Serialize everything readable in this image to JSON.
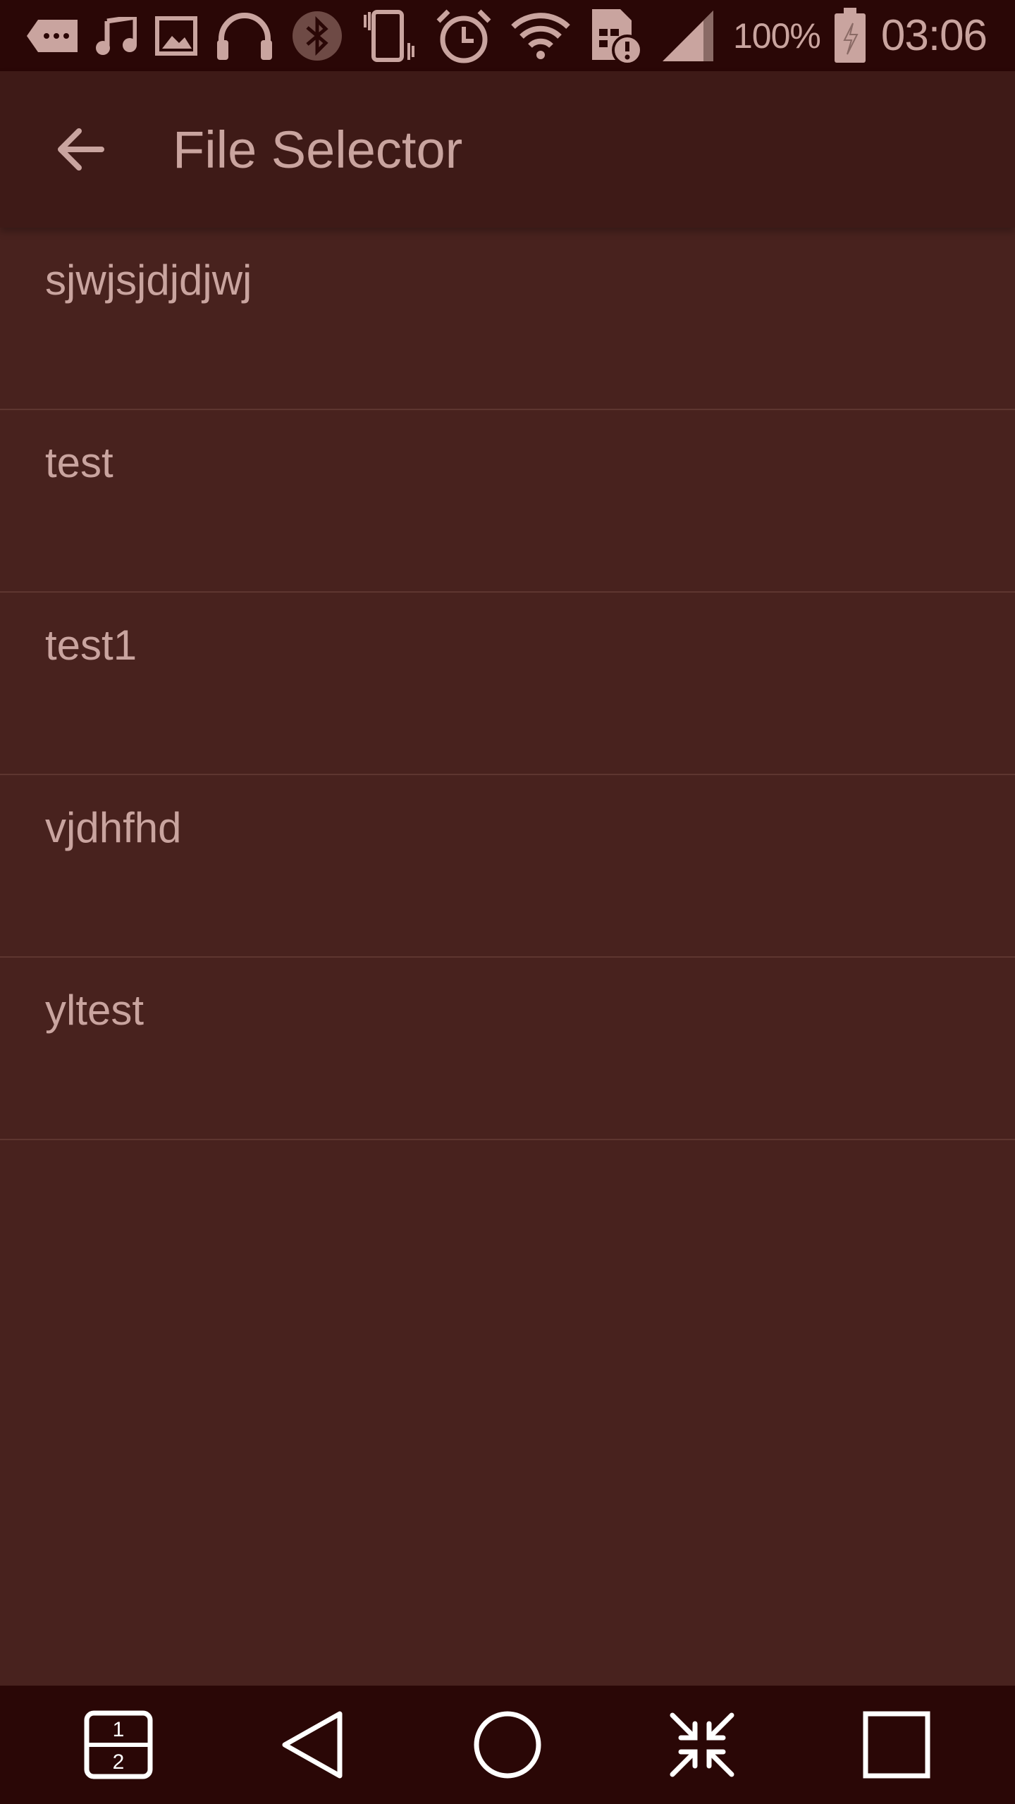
{
  "status_bar": {
    "icons": [
      "tag-icon",
      "music-icon",
      "image-icon",
      "headphones-icon",
      "bluetooth-icon",
      "vibrate-icon",
      "alarm-icon",
      "wifi-icon",
      "sim-alert-icon",
      "signal-icon",
      "battery-charging-icon"
    ],
    "battery_percent": "100%",
    "time": "03:06"
  },
  "app_bar": {
    "back_icon": "arrow-back-icon",
    "title": "File Selector"
  },
  "files": [
    {
      "name": "sjwjsjdjdjwj"
    },
    {
      "name": "test"
    },
    {
      "name": "test1"
    },
    {
      "name": "vjdhfhd"
    },
    {
      "name": "yltest"
    }
  ],
  "nav_bar": {
    "buttons": [
      "split-screen-icon",
      "back-triangle-icon",
      "home-circle-icon",
      "minimize-arrows-icon",
      "recents-square-icon"
    ]
  },
  "colors": {
    "status_bar_bg": "#2a0706",
    "app_bar_bg": "#3e1a17",
    "content_bg": "#48221e",
    "text": "#c9a49f",
    "divider": "#5e3630"
  }
}
